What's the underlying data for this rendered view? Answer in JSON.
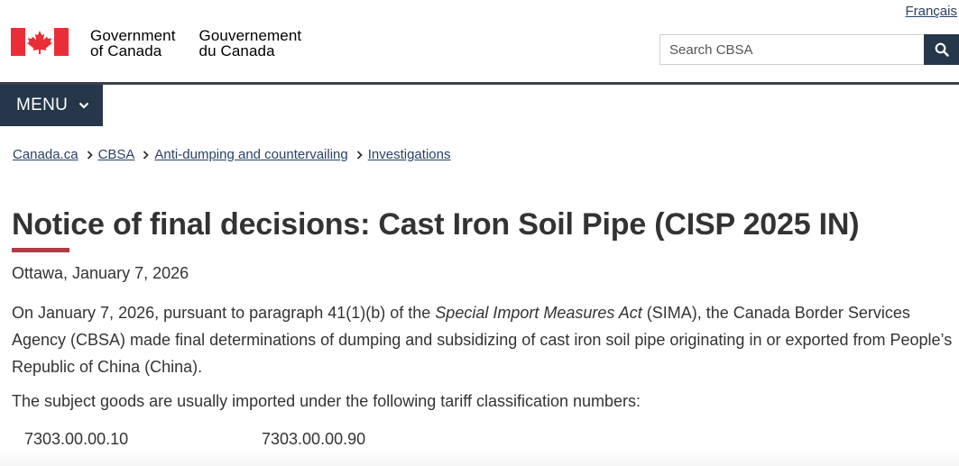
{
  "header": {
    "language_link": "Français",
    "gov_name_en_line1": "Government",
    "gov_name_en_line2": "of Canada",
    "gov_name_fr_line1": "Gouvernement",
    "gov_name_fr_line2": "du Canada",
    "search_placeholder": "Search CBSA",
    "flag_color": "#eb2d37"
  },
  "nav": {
    "menu_label": "MENU",
    "menu_bg": "#26374a"
  },
  "breadcrumb": [
    "Canada.ca",
    "CBSA",
    "Anti-dumping and countervailing",
    "Investigations"
  ],
  "main": {
    "title": "Notice of final decisions: Cast Iron Soil Pipe (CISP 2025 IN)",
    "title_accent_color": "#af3c43",
    "dateline": "Ottawa, January 7, 2026",
    "para1_before": "On January 7, 2026, pursuant to paragraph 41(1)(b) of the ",
    "para1_italic": "Special Import Measures Act",
    "para1_after": " (SIMA), the Canada Border Services Agency (CBSA) made final determinations of dumping and subsidizing of cast iron soil pipe originating in or exported from People’s Republic of China (China).",
    "para2": "The subject goods are usually imported under the following tariff classification numbers:",
    "tariff_codes": [
      "7303.00.00.10",
      "7303.00.00.90"
    ]
  }
}
